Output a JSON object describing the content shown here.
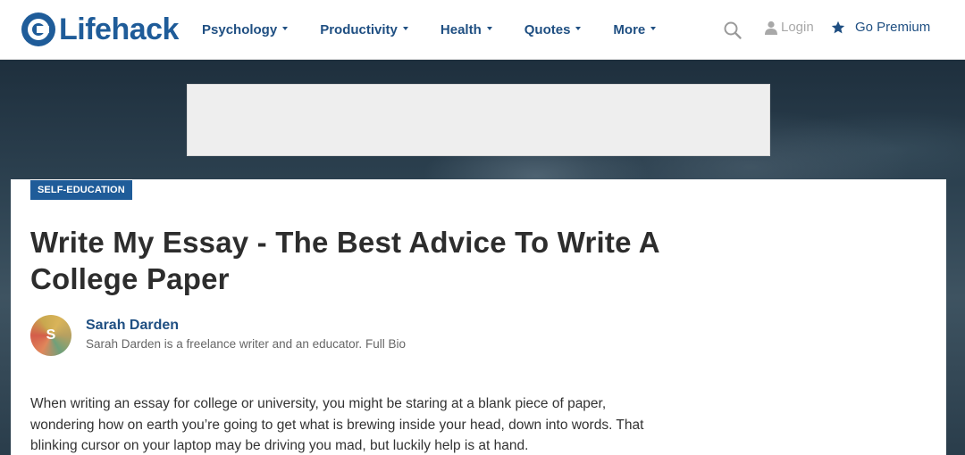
{
  "header": {
    "logo_text": "Lifehack",
    "nav": [
      {
        "label": "Psychology"
      },
      {
        "label": "Productivity"
      },
      {
        "label": "Health"
      },
      {
        "label": "Quotes"
      },
      {
        "label": "More"
      }
    ],
    "search_icon": "search-icon",
    "login_label": "Login",
    "premium_label": "Go Premium"
  },
  "colors": {
    "brand": "#1f5c99",
    "nav_text": "#1f4f82",
    "title_text": "#2d2d2d",
    "muted": "#a8a8a8"
  },
  "article": {
    "category": "SELF-EDUCATION",
    "title": "Write My Essay - The Best Advice To Write A College Paper",
    "author": {
      "initial": "S",
      "name": "Sarah Darden",
      "bio": "Sarah Darden is a freelance writer and an educator.",
      "bio_link": "Full Bio"
    },
    "intro": "When writing an essay for college or university, you might be staring at a blank piece of paper, wondering how on earth you’re going to get what is brewing inside your head, down into words. That blinking cursor on your laptop may be driving you mad, but luckily help is at hand."
  }
}
